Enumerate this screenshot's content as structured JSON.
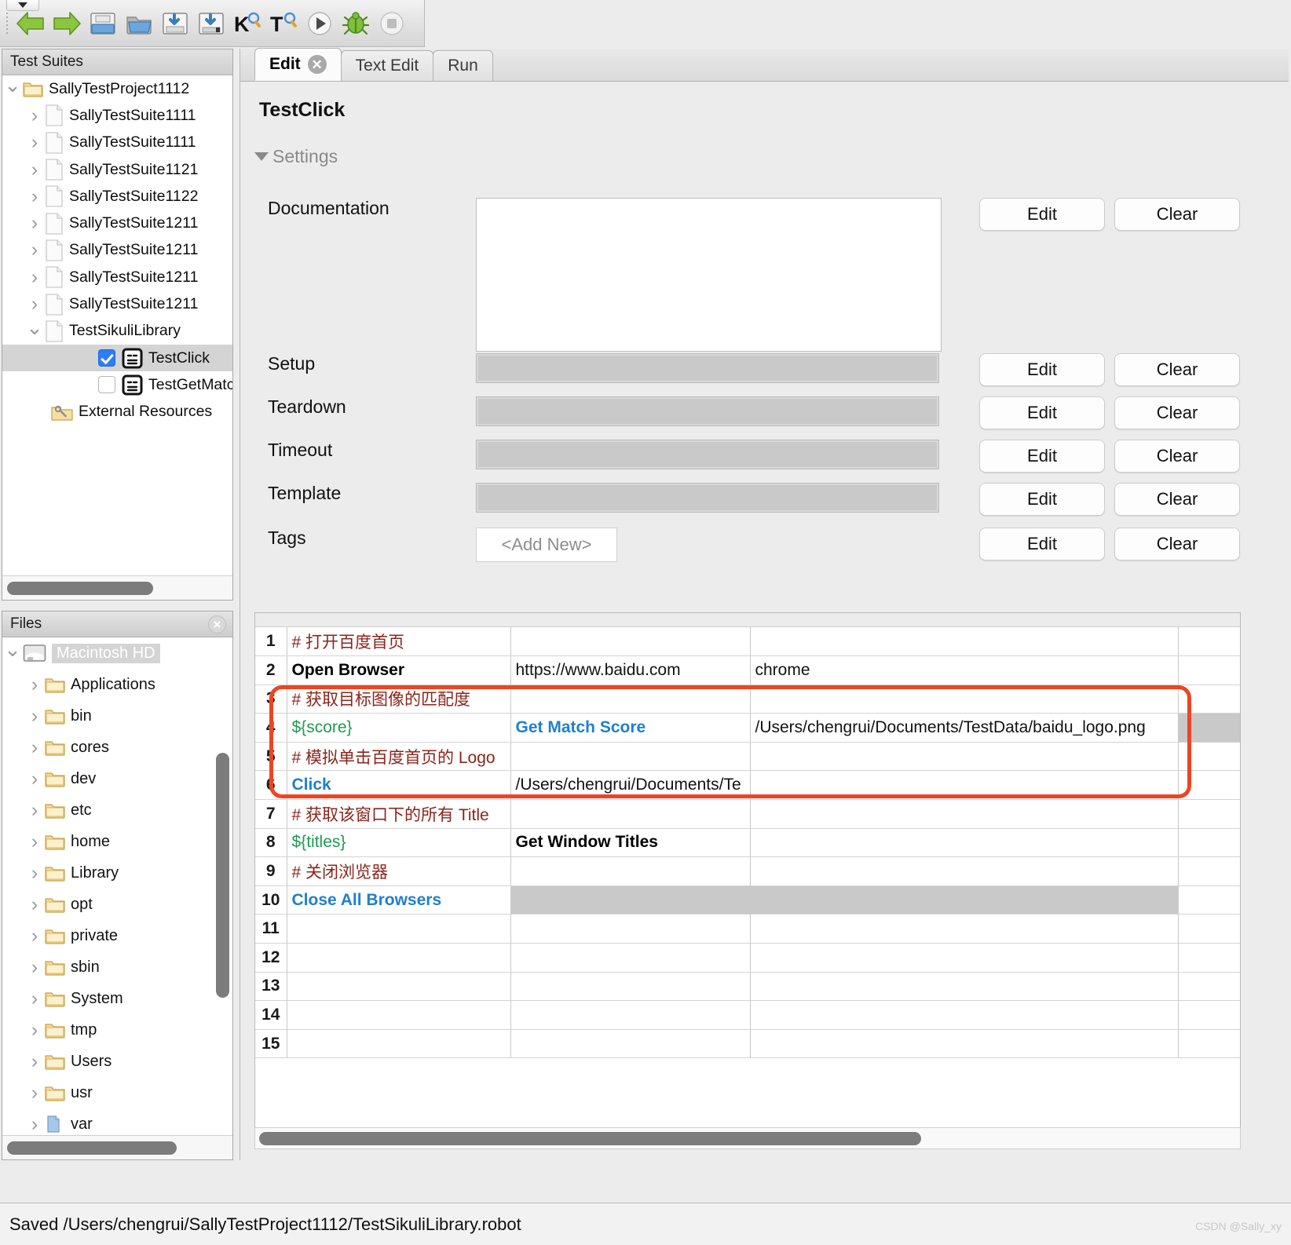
{
  "toolbar": {
    "icons": [
      {
        "name": "back-arrow-icon",
        "glyph": "back"
      },
      {
        "name": "forward-arrow-icon",
        "glyph": "forward"
      },
      {
        "name": "open-folder-icon",
        "glyph": "folder-open"
      },
      {
        "name": "open-directory-icon",
        "glyph": "folder"
      },
      {
        "name": "save-icon",
        "glyph": "save"
      },
      {
        "name": "save-all-icon",
        "glyph": "save-all"
      },
      {
        "name": "search-keyword-icon",
        "glyph": "K"
      },
      {
        "name": "search-tests-icon",
        "glyph": "T"
      },
      {
        "name": "run-icon",
        "glyph": "play"
      },
      {
        "name": "debug-icon",
        "glyph": "bug"
      },
      {
        "name": "stop-icon",
        "glyph": "stop"
      }
    ]
  },
  "suites": {
    "title": "Test Suites",
    "nodes": [
      {
        "label": "SallyTestProject1112",
        "icon": "folder-icon",
        "twist": "open",
        "indent": 22,
        "type": "folder",
        "selected": false
      },
      {
        "label": "SallyTestSuite1111",
        "icon": "file-icon",
        "twist": "closed",
        "indent": 54,
        "type": "file",
        "selected": false
      },
      {
        "label": "SallyTestSuite1111",
        "icon": "file-icon",
        "twist": "closed",
        "indent": 54,
        "type": "file",
        "selected": false
      },
      {
        "label": "SallyTestSuite1121",
        "icon": "file-icon",
        "twist": "closed",
        "indent": 54,
        "type": "file",
        "selected": false
      },
      {
        "label": "SallyTestSuite1122",
        "icon": "file-icon",
        "twist": "closed",
        "indent": 54,
        "type": "file",
        "selected": false
      },
      {
        "label": "SallyTestSuite1211",
        "icon": "file-icon",
        "twist": "closed",
        "indent": 54,
        "type": "file",
        "selected": false
      },
      {
        "label": "SallyTestSuite1211",
        "icon": "file-icon",
        "twist": "closed",
        "indent": 54,
        "type": "file",
        "selected": false
      },
      {
        "label": "SallyTestSuite1211",
        "icon": "file-icon",
        "twist": "closed",
        "indent": 54,
        "type": "file",
        "selected": false
      },
      {
        "label": "SallyTestSuite1211",
        "icon": "file-icon",
        "twist": "closed",
        "indent": 54,
        "type": "file",
        "selected": false
      },
      {
        "label": "TestSikuliLibrary",
        "icon": "file-icon",
        "twist": "open",
        "indent": 54,
        "type": "file",
        "selected": false
      },
      {
        "label": "TestClick",
        "icon": "testcase-icon",
        "twist": "none",
        "indent": 122,
        "type": "testcase",
        "selected": true,
        "checked": true
      },
      {
        "label": "TestGetMatchScore",
        "icon": "testcase-icon",
        "twist": "none",
        "indent": 122,
        "type": "testcase",
        "selected": false,
        "checked": false
      },
      {
        "label": "External Resources",
        "icon": "resources-icon",
        "twist": "none",
        "indent": 62,
        "type": "resources",
        "selected": false
      }
    ]
  },
  "files": {
    "title": "Files",
    "close_label": "×",
    "nodes": [
      {
        "label": "Macintosh HD",
        "icon": "drive-icon",
        "twist": "open",
        "indent": 22,
        "selected": true
      },
      {
        "label": "Applications",
        "icon": "folder-icon",
        "twist": "closed",
        "indent": 54,
        "selected": false
      },
      {
        "label": "bin",
        "icon": "folder-icon",
        "twist": "closed",
        "indent": 54,
        "selected": false
      },
      {
        "label": "cores",
        "icon": "folder-icon",
        "twist": "closed",
        "indent": 54,
        "selected": false
      },
      {
        "label": "dev",
        "icon": "folder-icon",
        "twist": "closed",
        "indent": 54,
        "selected": false
      },
      {
        "label": "etc",
        "icon": "folder-icon",
        "twist": "closed",
        "indent": 54,
        "selected": false
      },
      {
        "label": "home",
        "icon": "folder-icon",
        "twist": "closed",
        "indent": 54,
        "selected": false
      },
      {
        "label": "Library",
        "icon": "folder-icon",
        "twist": "closed",
        "indent": 54,
        "selected": false
      },
      {
        "label": "opt",
        "icon": "folder-icon",
        "twist": "closed",
        "indent": 54,
        "selected": false
      },
      {
        "label": "private",
        "icon": "folder-icon",
        "twist": "closed",
        "indent": 54,
        "selected": false
      },
      {
        "label": "sbin",
        "icon": "folder-icon",
        "twist": "closed",
        "indent": 54,
        "selected": false
      },
      {
        "label": "System",
        "icon": "folder-icon",
        "twist": "closed",
        "indent": 54,
        "selected": false
      },
      {
        "label": "tmp",
        "icon": "folder-icon",
        "twist": "closed",
        "indent": 54,
        "selected": false
      },
      {
        "label": "Users",
        "icon": "folder-icon",
        "twist": "closed",
        "indent": 54,
        "selected": false
      },
      {
        "label": "usr",
        "icon": "folder-icon",
        "twist": "closed",
        "indent": 54,
        "selected": false
      },
      {
        "label": "var",
        "icon": "alias-icon",
        "twist": "closed",
        "indent": 54,
        "selected": false
      }
    ]
  },
  "editor": {
    "tabs": [
      {
        "label": "Edit",
        "active": true,
        "closable": true
      },
      {
        "label": "Text Edit",
        "active": false,
        "closable": false
      },
      {
        "label": "Run",
        "active": false,
        "closable": false
      }
    ],
    "keyword_title": "TestClick",
    "settings_label": "Settings",
    "rows": [
      {
        "label": "Documentation",
        "field": "doc",
        "value": "",
        "edit": "Edit",
        "clear": "Clear"
      },
      {
        "label": "Setup",
        "field": "gray",
        "value": "",
        "edit": "Edit",
        "clear": "Clear"
      },
      {
        "label": "Teardown",
        "field": "gray",
        "value": "",
        "edit": "Edit",
        "clear": "Clear"
      },
      {
        "label": "Timeout",
        "field": "gray",
        "value": "",
        "edit": "Edit",
        "clear": "Clear"
      },
      {
        "label": "Template",
        "field": "gray",
        "value": "",
        "edit": "Edit",
        "clear": "Clear"
      },
      {
        "label": "Tags",
        "field": "tag",
        "value": "<Add New>",
        "edit": "Edit",
        "clear": "Clear"
      }
    ]
  },
  "grid": {
    "rows": [
      {
        "n": "1",
        "c1": "# 打开百度首页",
        "c1s": "cmt",
        "c2": "",
        "c2s": "plain",
        "c3": "",
        "c3s": "plain",
        "c4": "",
        "c4gray": false,
        "c2gray": false,
        "c3gray": false
      },
      {
        "n": "2",
        "c1": "Open Browser",
        "c1s": "bold",
        "c2": "https://www.baidu.com",
        "c2s": "plain",
        "c3": "chrome",
        "c3s": "plain",
        "c4": "",
        "c4gray": false,
        "c2gray": false,
        "c3gray": false
      },
      {
        "n": "3",
        "c1": "# 获取目标图像的匹配度",
        "c1s": "cmt",
        "c2": "",
        "c2s": "plain",
        "c3": "",
        "c3s": "plain",
        "c4": "",
        "c4gray": false,
        "c2gray": false,
        "c3gray": false
      },
      {
        "n": "4",
        "c1": "${score}",
        "c1s": "var",
        "c2": "Get Match Score",
        "c2s": "kw",
        "c3": "/Users/chengrui/Documents/TestData/baidu_logo.png",
        "c3s": "plain",
        "c4": "",
        "c4gray": true,
        "c2gray": false,
        "c3gray": false
      },
      {
        "n": "5",
        "c1": "# 模拟单击百度首页的 Logo",
        "c1s": "cmt",
        "c2": "",
        "c2s": "plain",
        "c3": "",
        "c3s": "plain",
        "c4": "",
        "c4gray": false,
        "c2gray": false,
        "c3gray": false
      },
      {
        "n": "6",
        "c1": "Click",
        "c1s": "kw",
        "c2": "/Users/chengrui/Documents/Te",
        "c2s": "plain",
        "c3": "",
        "c3s": "plain",
        "c4": "",
        "c4gray": false,
        "c2gray": false,
        "c3gray": false,
        "alt": true
      },
      {
        "n": "7",
        "c1": "# 获取该窗口下的所有 Title",
        "c1s": "cmt",
        "c2": "",
        "c2s": "plain",
        "c3": "",
        "c3s": "plain",
        "c4": "",
        "c4gray": false,
        "c2gray": false,
        "c3gray": false
      },
      {
        "n": "8",
        "c1": "${titles}",
        "c1s": "var",
        "c2": "Get Window Titles",
        "c2s": "bold",
        "c3": "",
        "c3s": "plain",
        "c4": "",
        "c4gray": false,
        "c2gray": false,
        "c3gray": false
      },
      {
        "n": "9",
        "c1": "# 关闭浏览器",
        "c1s": "cmt",
        "c2": "",
        "c2s": "plain",
        "c3": "",
        "c3s": "plain",
        "c4": "",
        "c4gray": false,
        "c2gray": false,
        "c3gray": false
      },
      {
        "n": "10",
        "c1": "Close All Browsers",
        "c1s": "kw",
        "c2": "",
        "c2s": "plain",
        "c3": "",
        "c3s": "plain",
        "c4": "",
        "c4gray": false,
        "c2gray": true,
        "c3gray": true
      },
      {
        "n": "11",
        "c1": "",
        "c1s": "plain",
        "c2": "",
        "c2s": "plain",
        "c3": "",
        "c3s": "plain",
        "c4": "",
        "c4gray": false,
        "c2gray": false,
        "c3gray": false
      },
      {
        "n": "12",
        "c1": "",
        "c1s": "plain",
        "c2": "",
        "c2s": "plain",
        "c3": "",
        "c3s": "plain",
        "c4": "",
        "c4gray": false,
        "c2gray": false,
        "c3gray": false
      },
      {
        "n": "13",
        "c1": "",
        "c1s": "plain",
        "c2": "",
        "c2s": "plain",
        "c3": "",
        "c3s": "plain",
        "c4": "",
        "c4gray": false,
        "c2gray": false,
        "c3gray": false
      },
      {
        "n": "14",
        "c1": "",
        "c1s": "plain",
        "c2": "",
        "c2s": "plain",
        "c3": "",
        "c3s": "plain",
        "c4": "",
        "c4gray": false,
        "c2gray": false,
        "c3gray": false
      },
      {
        "n": "15",
        "c1": "",
        "c1s": "plain",
        "c2": "",
        "c2s": "plain",
        "c3": "",
        "c3s": "plain",
        "c4": "",
        "c4gray": false,
        "c2gray": false,
        "c3gray": false
      }
    ],
    "highlight_color": "#ef4423"
  },
  "statusbar": {
    "message": "Saved /Users/chengrui/SallyTestProject1112/TestSikuliLibrary.robot",
    "watermark": "CSDN @Sally_xy"
  }
}
